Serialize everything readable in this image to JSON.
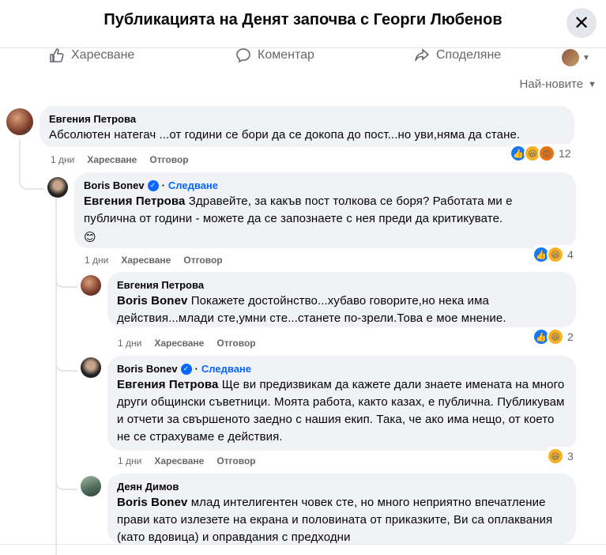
{
  "header": {
    "title": "Публикацията на Денят започва с Георги Любенов"
  },
  "actions": {
    "like": "Харесване",
    "comment": "Коментар",
    "share": "Споделяне"
  },
  "sort": {
    "label": "Най-новите"
  },
  "comments": [
    {
      "author": "Евгения Петрова",
      "text": "Абсолютен натегач ...от години се бори да се докопа до пост...но уви,няма да стане.",
      "time": "1 дни",
      "like": "Харесване",
      "reply": "Отговор",
      "reaction_count": "12"
    },
    {
      "author": "Boris Bonev",
      "follow": "Следване",
      "mention": "Евгения Петрова",
      "text": "Здравейте, за какъв пост толкова се боря? Работата ми е публична от години - можете да се запознаете с нея преди да критикувате.",
      "emoji": "😊",
      "time": "1 дни",
      "like": "Харесване",
      "reply": "Отговор",
      "reaction_count": "4"
    },
    {
      "author": "Евгения Петрова",
      "mention": "Boris Bonev",
      "text": "Покажете достойнство...хубаво говорите,но нека има действия...млади сте,умни сте...станете по-зрели.Това е мое мнение.",
      "time": "1 дни",
      "like": "Харесване",
      "reply": "Отговор",
      "reaction_count": "2"
    },
    {
      "author": "Boris Bonev",
      "follow": "Следване",
      "mention": "Евгения Петрова",
      "text": "Ще ви предизвикам да кажете дали знаете имената на много други общински съветници. Моята работа, както казах, е публична. Публикувам и отчети за свършеното заедно с нашия екип. Така, че ако има нещо, от което не се страхуваме е действия.",
      "time": "1 дни",
      "like": "Харесване",
      "reply": "Отговор",
      "reaction_count": "3"
    },
    {
      "author": "Деян Димов",
      "mention": "Boris Bonev",
      "text": "млад интелигентен човек сте, но много неприятно впечатление прави като излезете на екрана и половината от приказките, Ви са оплаквания (като вдовица) и оправдания с предходни"
    }
  ]
}
